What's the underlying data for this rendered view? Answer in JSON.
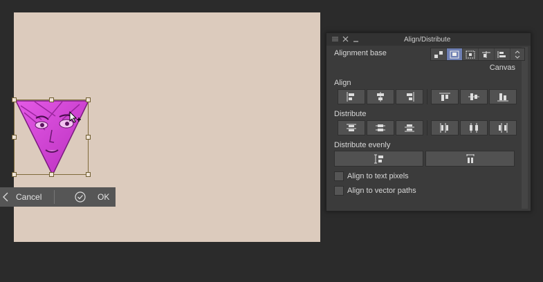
{
  "transform_bar": {
    "cancel_label": "Cancel",
    "ok_label": "OK"
  },
  "panel": {
    "title": "Align/Distribute",
    "alignment_base_label": "Alignment base",
    "alignment_base_value": "Canvas",
    "align_label": "Align",
    "distribute_label": "Distribute",
    "distribute_evenly_label": "Distribute evenly",
    "align_text_pixels_label": "Align to text pixels",
    "align_vector_paths_label": "Align to vector paths",
    "align_text_pixels_checked": false,
    "align_vector_paths_checked": false
  },
  "colors": {
    "canvas": "#dccbbd",
    "art": "#cf3fd2",
    "active_base": "#6e7fb3",
    "panel": "#3b3b3b"
  }
}
